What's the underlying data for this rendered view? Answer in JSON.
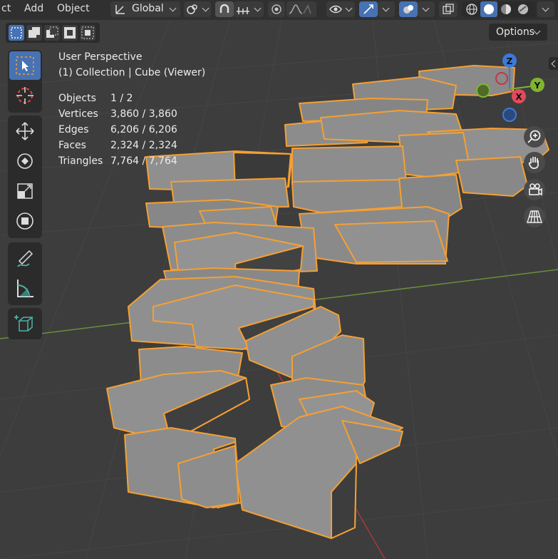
{
  "header": {
    "menus": [
      "ct",
      "Add",
      "Object"
    ],
    "transform_orientation": "Global"
  },
  "options_label": "Options",
  "overlay": {
    "view_name": "User Perspective",
    "collection_line": "(1) Collection | Cube (Viewer)"
  },
  "stats": [
    {
      "label": "Objects",
      "value": "1 / 2"
    },
    {
      "label": "Vertices",
      "value": "3,860 / 3,860"
    },
    {
      "label": "Edges",
      "value": "6,206 / 6,206"
    },
    {
      "label": "Faces",
      "value": "2,324 / 2,324"
    },
    {
      "label": "Triangles",
      "value": "7,764 / 7,764"
    }
  ],
  "gizmo": {
    "z": "Z",
    "y": "Y",
    "x": "X"
  },
  "colors": {
    "selection_outline": "#f5a033",
    "active_button": "#4772b3",
    "background": "#3d3d3d"
  }
}
